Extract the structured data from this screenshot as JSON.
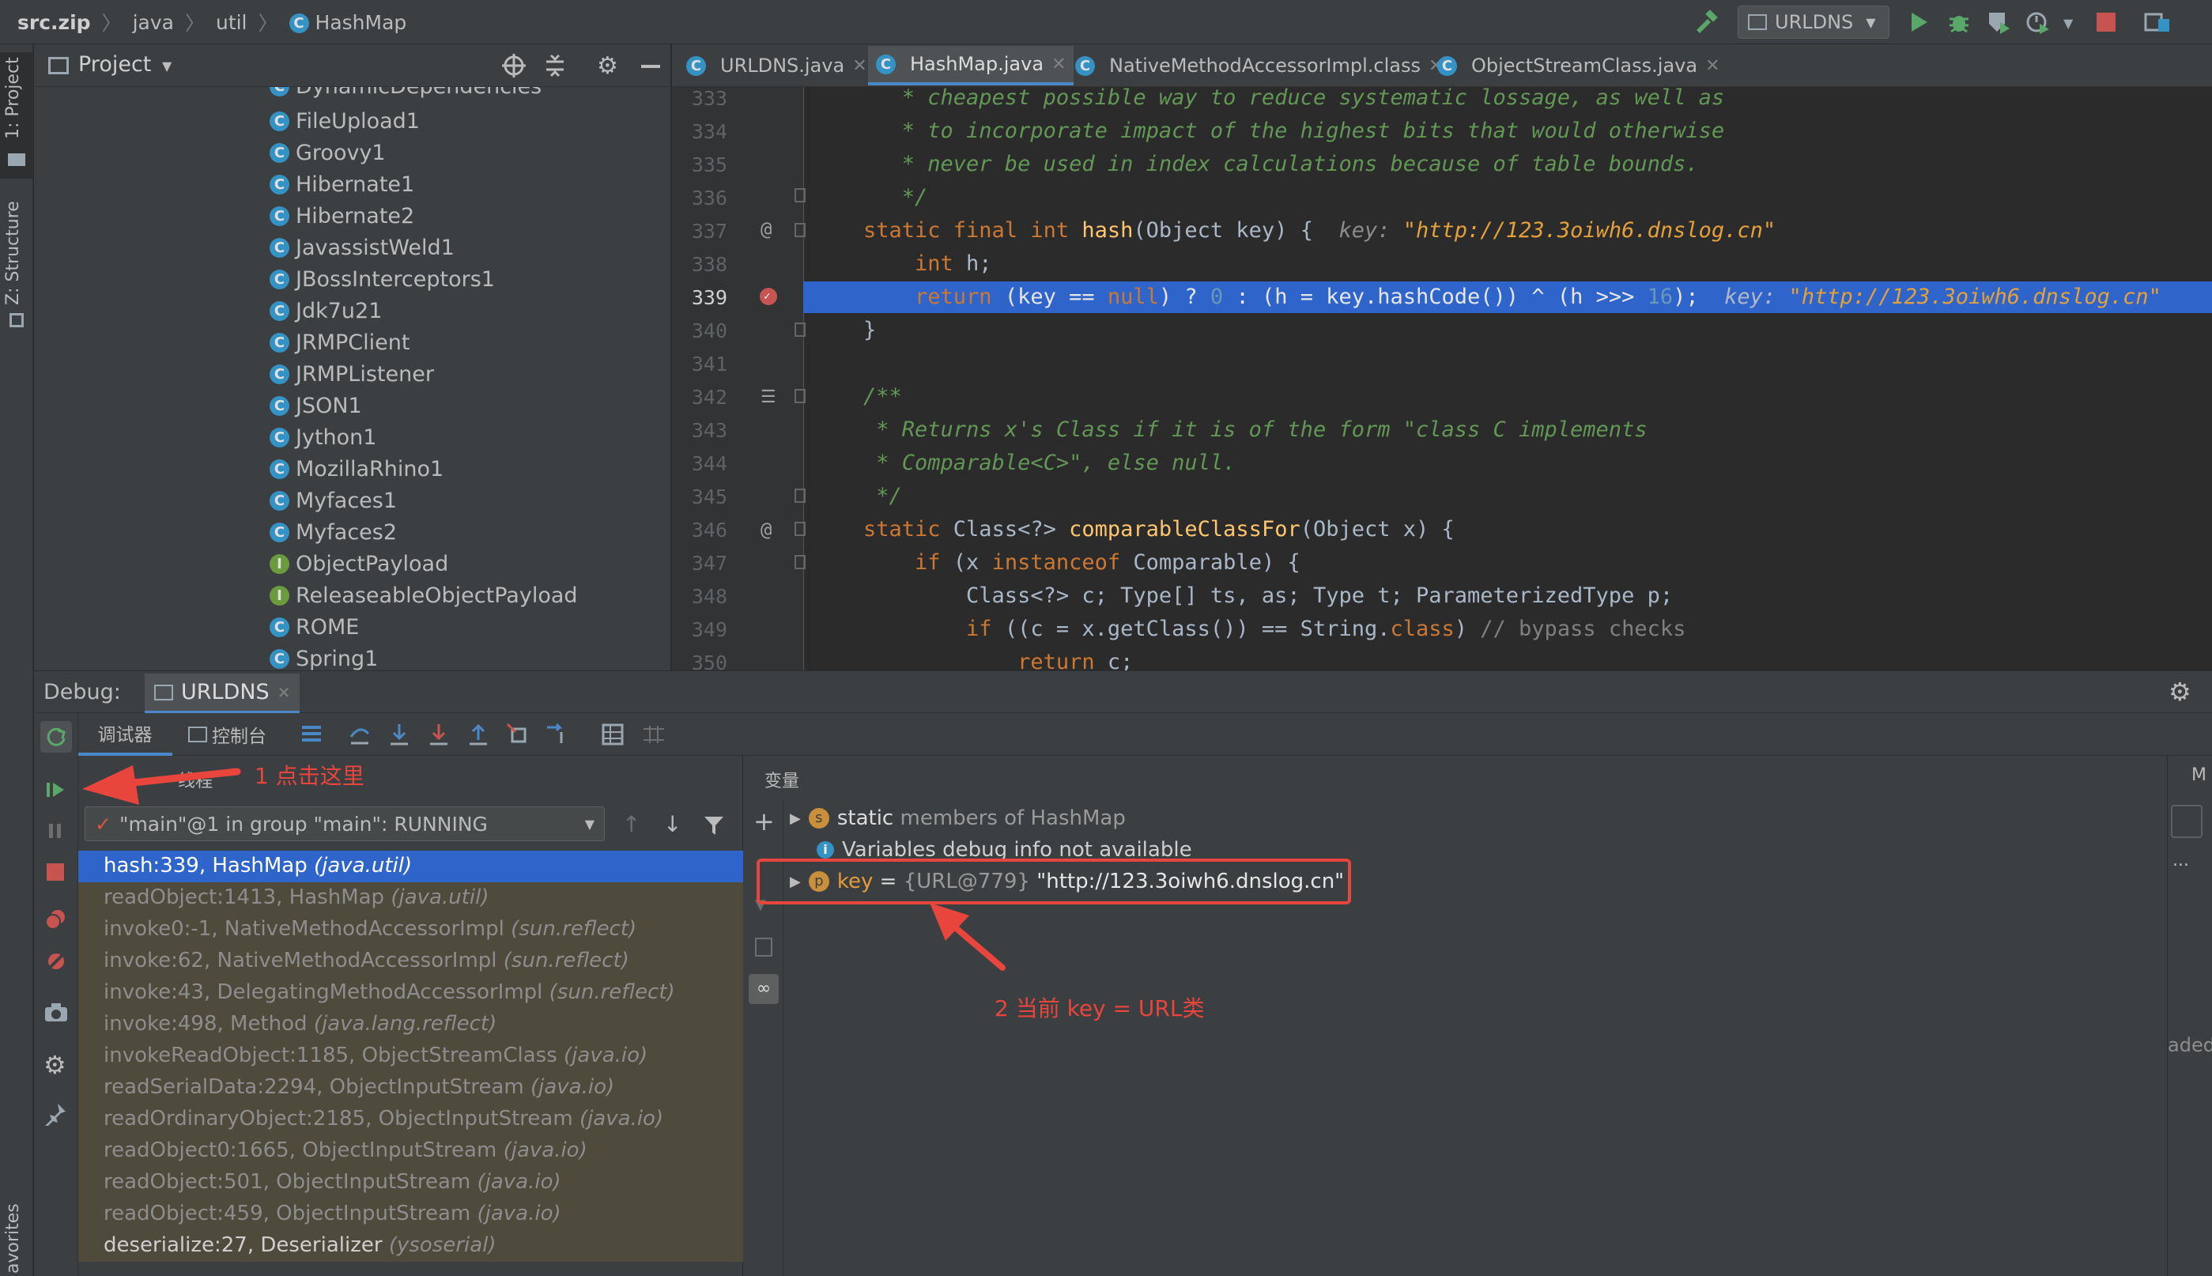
{
  "breadcrumb": {
    "items": [
      "src.zip",
      "java",
      "util",
      "HashMap"
    ]
  },
  "toolbar": {
    "run_config": "URLDNS"
  },
  "left_strip": {
    "project_label": "1: Project",
    "structure_label": "Z: Structure",
    "favorites_label": "avorites"
  },
  "project_panel": {
    "title": "Project",
    "items": [
      {
        "label": "DynamicDependencies",
        "kind": "class"
      },
      {
        "label": "FileUpload1",
        "kind": "class"
      },
      {
        "label": "Groovy1",
        "kind": "class"
      },
      {
        "label": "Hibernate1",
        "kind": "class"
      },
      {
        "label": "Hibernate2",
        "kind": "class"
      },
      {
        "label": "JavassistWeld1",
        "kind": "class"
      },
      {
        "label": "JBossInterceptors1",
        "kind": "class"
      },
      {
        "label": "Jdk7u21",
        "kind": "class"
      },
      {
        "label": "JRMPClient",
        "kind": "class"
      },
      {
        "label": "JRMPListener",
        "kind": "class"
      },
      {
        "label": "JSON1",
        "kind": "class"
      },
      {
        "label": "Jython1",
        "kind": "class"
      },
      {
        "label": "MozillaRhino1",
        "kind": "class"
      },
      {
        "label": "Myfaces1",
        "kind": "class"
      },
      {
        "label": "Myfaces2",
        "kind": "class"
      },
      {
        "label": "ObjectPayload",
        "kind": "interface"
      },
      {
        "label": "ReleaseableObjectPayload",
        "kind": "interface"
      },
      {
        "label": "ROME",
        "kind": "class"
      },
      {
        "label": "Spring1",
        "kind": "class"
      }
    ]
  },
  "editor_tabs": [
    {
      "label": "URLDNS.java",
      "active": false
    },
    {
      "label": "HashMap.java",
      "active": true
    },
    {
      "label": "NativeMethodAccessorImpl.class",
      "active": false
    },
    {
      "label": "ObjectStreamClass.java",
      "active": false
    }
  ],
  "code": {
    "lines": [
      {
        "n": "333",
        "t": "   * cheapest possible way to reduce systematic lossage, as well as"
      },
      {
        "n": "334",
        "t": "   * to incorporate impact of the highest bits that would otherwise"
      },
      {
        "n": "335",
        "t": "   * never be used in index calculations because of table bounds."
      },
      {
        "n": "336",
        "t": "   */"
      },
      {
        "n": "337",
        "a": "static final int ",
        "b": "hash",
        "c": "(Object key) {  ",
        "h1": "key: ",
        "h2": "\"http://123.3oiwh6.dnslog.cn\""
      },
      {
        "n": "338",
        "a": "    int ",
        "c": "h;"
      },
      {
        "n": "339",
        "a": "    return ",
        "c": "(key == ",
        "k2": "null",
        "d": ") ? ",
        "z": "0",
        "e": " : (h = key.hashCode()) ^ (h >>> ",
        "s": "16",
        "f": ");  ",
        "h1": "key: ",
        "h2": "\"http://123.3oiwh6.dnslog.cn\""
      },
      {
        "n": "340",
        "c": "}"
      },
      {
        "n": "341",
        "c": ""
      },
      {
        "n": "342",
        "t": "/**"
      },
      {
        "n": "343",
        "t": " * Returns x's Class if it is of the form \"class C implements"
      },
      {
        "n": "344",
        "t": " * Comparable<C>\", else null."
      },
      {
        "n": "345",
        "t": " */"
      },
      {
        "n": "346",
        "a": "static ",
        "c": "Class<?> ",
        "b": "comparableClassFor",
        "d": "(Object x) {"
      },
      {
        "n": "347",
        "a": "    if ",
        "c": "(x ",
        "k2": "instanceof ",
        "d": "Comparable) {"
      },
      {
        "n": "348",
        "c": "        Class<?> c; Type[] ts, as; Type t; ParameterizedType p;"
      },
      {
        "n": "349",
        "a": "        if ",
        "c": "((c = x.getClass()) == String.",
        "k2": "class",
        "d": ") ",
        "cm": "// bypass checks"
      },
      {
        "n": "350",
        "a": "            return ",
        "c": "c;"
      }
    ]
  },
  "debug": {
    "label": "Debug:",
    "session": "URLDNS",
    "tab_debugger": "调试器",
    "tab_console": "控制台",
    "threads_header": "线程",
    "thread_select": "\"main\"@1 in group \"main\": RUNNING",
    "variables_header": "变量",
    "frames": [
      {
        "m": "hash:339, HashMap ",
        "p": "(java.util)",
        "state": "current"
      },
      {
        "m": "readObject:1413, HashMap ",
        "p": "(java.util)",
        "state": "lib"
      },
      {
        "m": "invoke0:-1, NativeMethodAccessorImpl ",
        "p": "(sun.reflect)",
        "state": "lib"
      },
      {
        "m": "invoke:62, NativeMethodAccessorImpl ",
        "p": "(sun.reflect)",
        "state": "lib"
      },
      {
        "m": "invoke:43, DelegatingMethodAccessorImpl ",
        "p": "(sun.reflect)",
        "state": "lib"
      },
      {
        "m": "invoke:498, Method ",
        "p": "(java.lang.reflect)",
        "state": "lib"
      },
      {
        "m": "invokeReadObject:1185, ObjectStreamClass ",
        "p": "(java.io)",
        "state": "lib"
      },
      {
        "m": "readSerialData:2294, ObjectInputStream ",
        "p": "(java.io)",
        "state": "lib"
      },
      {
        "m": "readOrdinaryObject:2185, ObjectInputStream ",
        "p": "(java.io)",
        "state": "lib"
      },
      {
        "m": "readObject0:1665, ObjectInputStream ",
        "p": "(java.io)",
        "state": "lib"
      },
      {
        "m": "readObject:501, ObjectInputStream ",
        "p": "(java.io)",
        "state": "lib"
      },
      {
        "m": "readObject:459, ObjectInputStream ",
        "p": "(java.io)",
        "state": "lib"
      },
      {
        "m": "deserialize:27, Deserializer ",
        "p": "(ysoserial)",
        "state": "normal"
      }
    ],
    "variables": {
      "static_a": "static ",
      "static_b": "members of HashMap",
      "info": "Variables debug info not available",
      "key_name": "key",
      "key_eq": " = ",
      "key_ref": "{URL@779} ",
      "key_val": "\"http://123.3oiwh6.dnslog.cn\""
    },
    "right_clip_a": "M",
    "right_clip_b": "...",
    "right_clip_c": "aded"
  },
  "annotations": {
    "note1": "1 点击这里",
    "note2": "2 当前 key = URL类"
  },
  "colors": {
    "accent": "#2f65ca",
    "annotation": "#e8453c",
    "comment": "#629755",
    "keyword": "#cc7832",
    "string": "#e5a139"
  }
}
